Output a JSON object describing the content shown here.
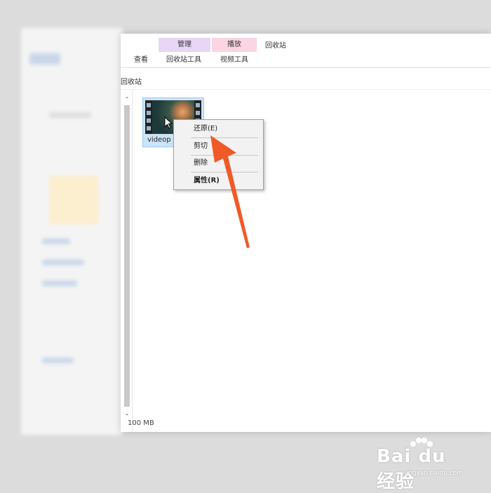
{
  "ribbon": {
    "ctx_manage": "管理",
    "ctx_play": "播放",
    "window_title": "回收站",
    "tabs": [
      {
        "label": "查看"
      },
      {
        "label": "回收站工具"
      },
      {
        "label": "视频工具"
      }
    ],
    "colors": {
      "manage": "#e9d5f4",
      "play": "#fbd5e3"
    }
  },
  "address": {
    "path": "回收站"
  },
  "file": {
    "name": "videop",
    "icon": "video-file-icon"
  },
  "context_menu": {
    "items": [
      {
        "label": "还原(E)"
      },
      {
        "label": "剪切"
      },
      {
        "label": "删除"
      },
      {
        "label": "属性(R)"
      }
    ]
  },
  "status": {
    "size": "100 MB"
  },
  "watermark": {
    "logo": "Bai du 经验",
    "url": "jingyan.baidu.com"
  },
  "annotation": {
    "arrow_color": "#f05a28"
  }
}
